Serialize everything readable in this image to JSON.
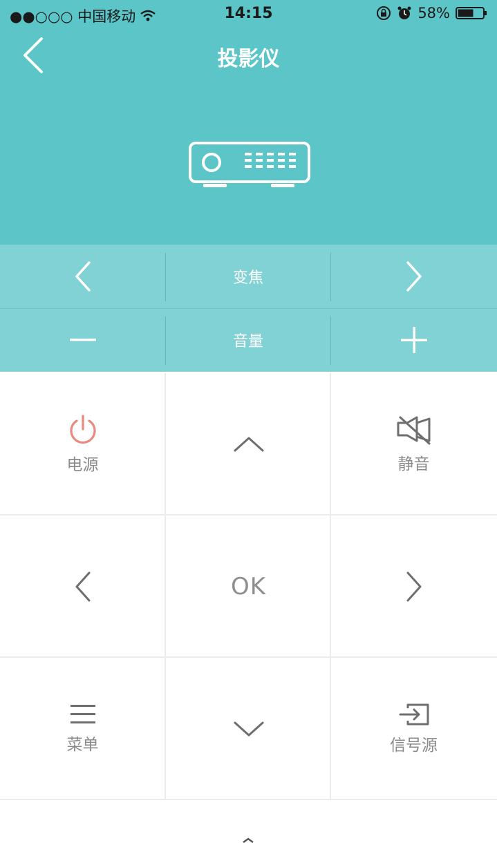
{
  "status_bar": {
    "carrier": "●●○○○ 中国移动",
    "time": "14:15",
    "battery": "58%"
  },
  "header": {
    "title": "投影仪"
  },
  "controls": {
    "zoom_label": "变焦",
    "volume_label": "音量"
  },
  "grid": {
    "power_label": "电源",
    "mute_label": "静音",
    "ok_label": "OK",
    "menu_label": "菜单",
    "source_label": "信号源"
  },
  "colors": {
    "accent": "#5bc5c7",
    "control_row": "#80d2d4",
    "power": "#e88a80"
  }
}
